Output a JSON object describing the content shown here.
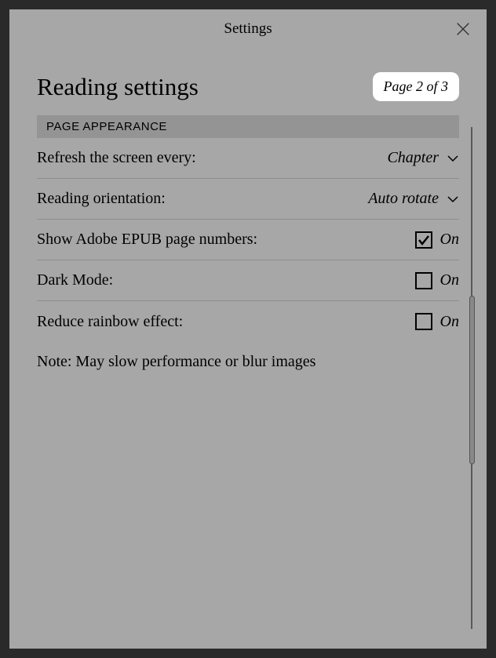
{
  "header": {
    "title": "Settings"
  },
  "page": {
    "title": "Reading settings",
    "badge": "Page 2 of 3"
  },
  "section": {
    "header": "PAGE APPEARANCE"
  },
  "settings": {
    "refresh": {
      "label": "Refresh the screen every:",
      "value": "Chapter"
    },
    "orientation": {
      "label": "Reading orientation:",
      "value": "Auto rotate"
    },
    "adobe": {
      "label": "Show Adobe EPUB page numbers:",
      "state": "On",
      "checked": true
    },
    "darkmode": {
      "label": "Dark Mode:",
      "state": "On",
      "checked": false
    },
    "rainbow": {
      "label": "Reduce rainbow effect:",
      "state": "On",
      "checked": false
    },
    "note": "Note: May slow performance or blur images"
  }
}
